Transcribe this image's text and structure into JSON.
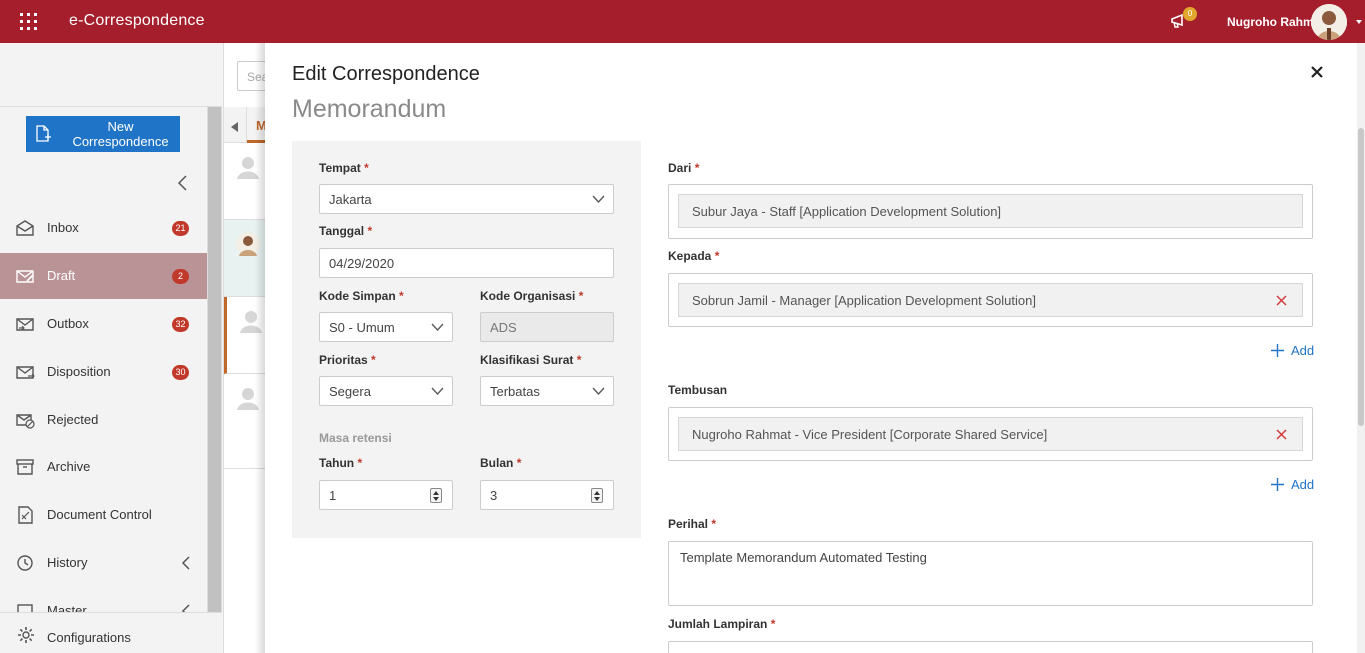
{
  "header": {
    "app_title": "e-Correspondence",
    "notification_count": "0",
    "user_name": "Nugroho Rahm"
  },
  "sidebar": {
    "new_button": "New Correspondence",
    "items": [
      {
        "label": "Inbox",
        "badge": "21",
        "icon": "inbox-icon"
      },
      {
        "label": "Draft",
        "badge": "2",
        "icon": "draft-icon",
        "active": true
      },
      {
        "label": "Outbox",
        "badge": "32",
        "icon": "outbox-icon"
      },
      {
        "label": "Disposition",
        "badge": "30",
        "icon": "disposition-icon"
      },
      {
        "label": "Rejected",
        "icon": "rejected-icon"
      },
      {
        "label": "Archive",
        "icon": "archive-icon"
      },
      {
        "label": "Document Control",
        "icon": "document-control-icon"
      },
      {
        "label": "History",
        "icon": "history-icon"
      },
      {
        "label": "Master",
        "icon": "master-icon"
      }
    ],
    "config_label": "Configurations"
  },
  "middle": {
    "search_placeholder": "Sea",
    "tab_label": "M"
  },
  "form": {
    "title": "Edit Correspondence",
    "subtitle": "Memorandum",
    "tempat": {
      "label": "Tempat",
      "value": "Jakarta"
    },
    "tanggal": {
      "label": "Tanggal",
      "value": "04/29/2020"
    },
    "kode_simpan": {
      "label": "Kode Simpan",
      "value": "S0 - Umum"
    },
    "kode_organisasi": {
      "label": "Kode Organisasi",
      "value": "ADS"
    },
    "prioritas": {
      "label": "Prioritas",
      "value": "Segera"
    },
    "klasifikasi": {
      "label": "Klasifikasi Surat",
      "value": "Terbatas"
    },
    "masa_retensi": "Masa retensi",
    "tahun": {
      "label": "Tahun",
      "value": "1"
    },
    "bulan": {
      "label": "Bulan",
      "value": "3"
    },
    "dari": {
      "label": "Dari",
      "value": "Subur Jaya - Staff [Application Development Solution]"
    },
    "kepada": {
      "label": "Kepada",
      "value": "Sobrun Jamil - Manager [Application Development Solution]"
    },
    "tembusan": {
      "label": "Tembusan",
      "value": "Nugroho Rahmat - Vice President [Corporate Shared Service]"
    },
    "add_label": "Add",
    "perihal": {
      "label": "Perihal",
      "value": "Template Memorandum Automated Testing"
    },
    "jumlah_lampiran": {
      "label": "Jumlah Lampiran"
    },
    "required_mark": "*"
  },
  "colors": {
    "brand": "#a41e2c",
    "primary": "#1f74c7",
    "badge": "#c0392b",
    "active_nav": "#ba9397"
  }
}
